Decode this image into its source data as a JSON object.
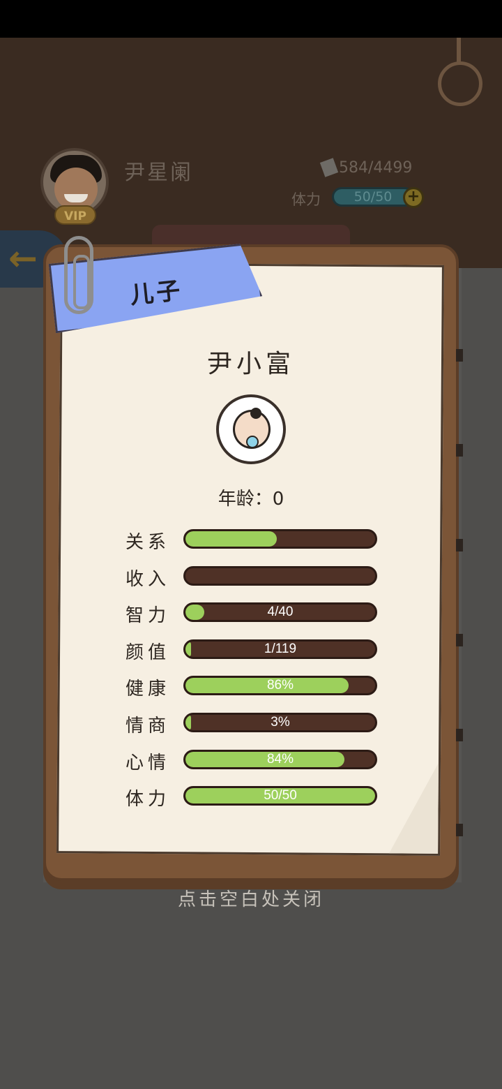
{
  "header": {
    "player_name": "尹星阑",
    "avatar_badge": "VIP",
    "money": "584/4499",
    "stamina_label": "体力",
    "stamina_value": "50/50",
    "plus_icon": "+",
    "back_icon": "arrow-left-icon"
  },
  "card": {
    "ribbon_label": "儿子",
    "child_name": "尹小富",
    "age_text": "年龄：0",
    "stats": [
      {
        "label": "关系",
        "value_text": "",
        "fill": 0.48
      },
      {
        "label": "收入",
        "value_text": "",
        "fill": 0
      },
      {
        "label": "智力",
        "value_text": "4/40",
        "fill": 0.1
      },
      {
        "label": "颜值",
        "value_text": "1/119",
        "fill": 0.01
      },
      {
        "label": "健康",
        "value_text": "86%",
        "fill": 0.86
      },
      {
        "label": "情商",
        "value_text": "3%",
        "fill": 0.03
      },
      {
        "label": "心情",
        "value_text": "84%",
        "fill": 0.84
      },
      {
        "label": "体力",
        "value_text": "50/50",
        "fill": 1.0
      }
    ]
  },
  "footer": {
    "close_hint": "点击空白处关闭"
  },
  "colors": {
    "bar_fill": "#9dd05c",
    "bar_track": "#4f3126",
    "ribbon": "#8aa4f2",
    "board": "#7b5537",
    "paper": "#f6efe2"
  }
}
